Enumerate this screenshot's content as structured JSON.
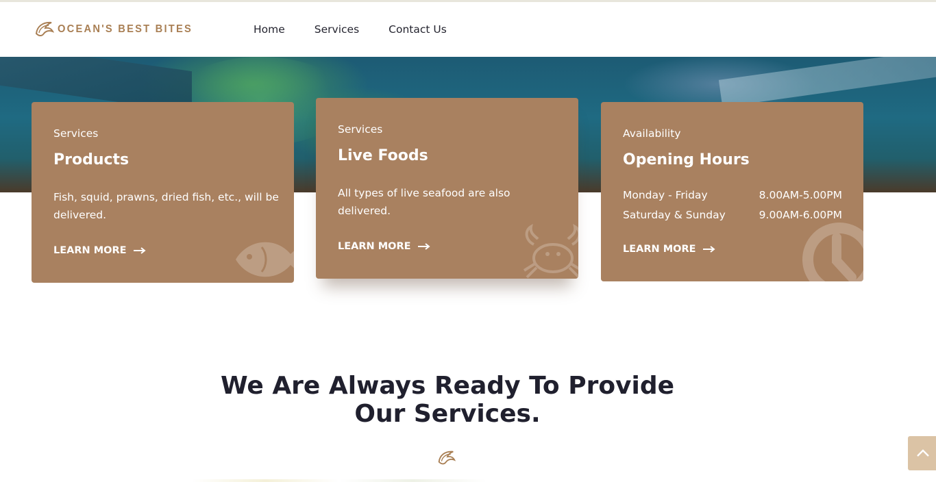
{
  "brand": {
    "name": "OCEAN'S BEST BITES",
    "logo_icon": "fish-logo-icon",
    "color": "#a97f54"
  },
  "nav": {
    "items": [
      "Home",
      "Services",
      "Contact Us"
    ]
  },
  "cards": [
    {
      "subtitle": "Services",
      "title": "Products",
      "description": "Fish, squid, prawns, dried fish, etc., will be delivered.",
      "cta": "LEARN MORE",
      "icon": "fish-icon"
    },
    {
      "subtitle": "Services",
      "title": "Live Foods",
      "description": "All types of live seafood are also delivered.",
      "cta": "LEARN MORE",
      "icon": "crab-icon"
    },
    {
      "subtitle": "Availability",
      "title": "Opening Hours",
      "hours": [
        {
          "days": "Monday - Friday",
          "time": "8.00AM-5.00PM"
        },
        {
          "days": "Saturday & Sunday",
          "time": "9.00AM-6.00PM"
        }
      ],
      "cta": "LEARN MORE",
      "icon": "clock-icon"
    }
  ],
  "section": {
    "title": "We Are Always Ready To Provide Our Services.",
    "icon": "fish-logo-icon"
  },
  "colors": {
    "card": "#a98160",
    "heading": "#20202e",
    "back_to_top": "#dbc3a5"
  },
  "back_to_top": {
    "icon": "chevron-up-icon"
  }
}
